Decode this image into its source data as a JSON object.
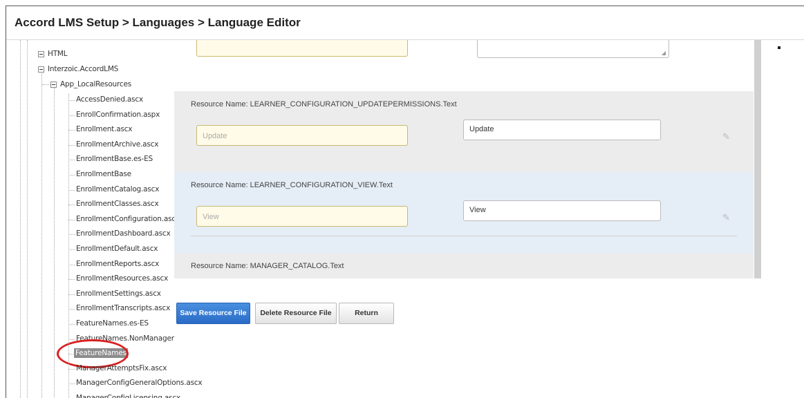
{
  "page": {
    "title": "Accord LMS Setup > Languages > Language Editor"
  },
  "tree": {
    "top_nodes": [
      {
        "label": "HTML",
        "expanded": true
      },
      {
        "label": "Interzoic.AccordLMS",
        "expanded": true
      }
    ],
    "folder": {
      "label": "App_LocalResources",
      "expanded": true
    },
    "files": [
      "AccessDenied.ascx",
      "EnrollConfirmation.aspx",
      "Enrollment.ascx",
      "EnrollmentArchive.ascx",
      "EnrollmentBase.es-ES",
      "EnrollmentBase",
      "EnrollmentCatalog.ascx",
      "EnrollmentClasses.ascx",
      "EnrollmentConfiguration.ascx",
      "EnrollmentDashboard.ascx",
      "EnrollmentDefault.ascx",
      "EnrollmentReports.ascx",
      "EnrollmentResources.ascx",
      "EnrollmentSettings.ascx",
      "EnrollmentTranscripts.ascx",
      "FeatureNames.es-ES",
      "FeatureNames.NonManager",
      "FeatureNames",
      "ManagerAttemptsFix.ascx",
      "ManagerConfigGeneralOptions.ascx",
      "ManagerConfigLicensing.ascx"
    ],
    "selected": "FeatureNames"
  },
  "editor": {
    "resources": [
      {
        "name": "Resource Name: LEARNER_CONFIGURATION_UPDATEPERMISSIONS.Text",
        "default_value": "Update",
        "value": "Update"
      },
      {
        "name": "Resource Name: LEARNER_CONFIGURATION_VIEW.Text",
        "default_value": "View",
        "value": "View"
      },
      {
        "name": "Resource Name: MANAGER_CATALOG.Text"
      }
    ]
  },
  "buttons": {
    "save": "Save Resource File",
    "delete": "Delete Resource File",
    "return": "Return"
  },
  "colors": {
    "primary_button": "#2a6cc6",
    "highlight_ring": "#d92020",
    "selected_node": "#8c8c8c"
  }
}
